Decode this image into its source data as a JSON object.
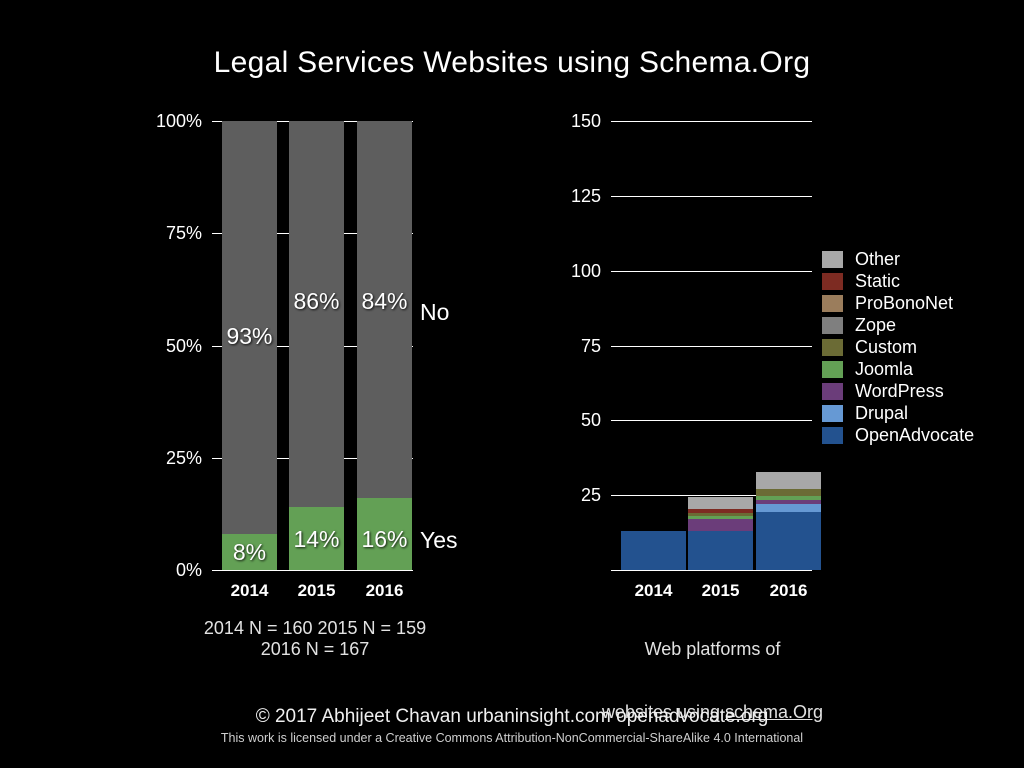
{
  "title": "Legal Services Websites using Schema.Org",
  "left_caption": "2014 N = 160  2015 N = 159\n2016 N = 167",
  "right_caption_line1": "Web platforms of",
  "right_caption_line2_prefix": "websites using ",
  "right_caption_link": "schema.Org",
  "footer": {
    "copyright": "© 2017  Abhijeet Chavan  urbaninsight.com  openadvocate.org",
    "license": "This work is licensed under a Creative Commons Attribution-NonCommercial-ShareAlike 4.0 International"
  },
  "colors": {
    "background": "#000000",
    "no_gray": "#5e5e5e",
    "yes_green": "#63a055",
    "axis": "#ffffff",
    "other": "#a8a8a8",
    "static": "#7d2b22",
    "probononet": "#9b7d5c",
    "zope": "#7f7f7f",
    "custom": "#6b6b35",
    "joomla": "#63a055",
    "wordpress": "#6b3d7a",
    "drupal": "#6699d4",
    "openadvocate": "#23528f"
  },
  "legend": {
    "items": [
      {
        "label": "Other",
        "color": "#a8a8a8"
      },
      {
        "label": "Static",
        "color": "#7d2b22"
      },
      {
        "label": "ProBonoNet",
        "color": "#9b7d5c"
      },
      {
        "label": "Zope",
        "color": "#7f7f7f"
      },
      {
        "label": "Custom",
        "color": "#6b6b35"
      },
      {
        "label": "Joomla",
        "color": "#63a055"
      },
      {
        "label": "WordPress",
        "color": "#6b3d7a"
      },
      {
        "label": "Drupal",
        "color": "#6699d4"
      },
      {
        "label": "OpenAdvocate",
        "color": "#23528f"
      }
    ]
  },
  "chart_data": [
    {
      "id": "schema-adoption",
      "type": "bar",
      "stacked": true,
      "normalized": true,
      "title": "Legal Services Websites using Schema.Org",
      "xlabel": "",
      "ylabel": "",
      "ylim": [
        0,
        100
      ],
      "yticks": [
        0,
        25,
        50,
        75,
        100
      ],
      "ytick_labels": [
        "0%",
        "25%",
        "50%",
        "75%",
        "100%"
      ],
      "grid": true,
      "legend_position": "right-of-bars",
      "categories": [
        "2014",
        "2015",
        "2016"
      ],
      "series": [
        {
          "name": "Yes",
          "color": "#63a055",
          "values": [
            8,
            14,
            16
          ],
          "labels": [
            "8%",
            "14%",
            "16%"
          ]
        },
        {
          "name": "No",
          "color": "#5e5e5e",
          "values": [
            92,
            86,
            84
          ],
          "labels": [
            "93%",
            "86%",
            "84%"
          ]
        }
      ],
      "sample_sizes": {
        "2014": 160,
        "2015": 159,
        "2016": 167
      },
      "caption": "2014 N = 160  2015 N = 159  2016 N = 167"
    },
    {
      "id": "web-platforms",
      "type": "bar",
      "stacked": true,
      "normalized": false,
      "title": "Web platforms of websites using schema.Org",
      "xlabel": "",
      "ylabel": "",
      "ylim": [
        0,
        150
      ],
      "yticks": [
        25,
        50,
        75,
        100,
        125,
        150
      ],
      "ytick_labels": [
        "25",
        "50",
        "75",
        "100",
        "125",
        "150"
      ],
      "grid": true,
      "legend_position": "right",
      "categories": [
        "2014",
        "2015",
        "2016"
      ],
      "series": [
        {
          "name": "OpenAdvocate",
          "color": "#23528f",
          "values": [
            13,
            13,
            20
          ]
        },
        {
          "name": "Drupal",
          "color": "#6699d4",
          "values": [
            0,
            0,
            2
          ]
        },
        {
          "name": "WordPress",
          "color": "#6b3d7a",
          "values": [
            0,
            4,
            1
          ]
        },
        {
          "name": "Joomla",
          "color": "#63a055",
          "values": [
            0,
            1,
            1
          ]
        },
        {
          "name": "Custom",
          "color": "#6b6b35",
          "values": [
            0,
            1,
            1
          ]
        },
        {
          "name": "Zope",
          "color": "#7f7f7f",
          "values": [
            0,
            0,
            0
          ]
        },
        {
          "name": "ProBonoNet",
          "color": "#9b7d5c",
          "values": [
            0,
            0,
            0
          ]
        },
        {
          "name": "Static",
          "color": "#7d2b22",
          "values": [
            0,
            1,
            0
          ]
        },
        {
          "name": "Other",
          "color": "#a8a8a8",
          "values": [
            0,
            4,
            3
          ]
        }
      ],
      "totals": [
        13,
        24,
        28
      ]
    }
  ]
}
